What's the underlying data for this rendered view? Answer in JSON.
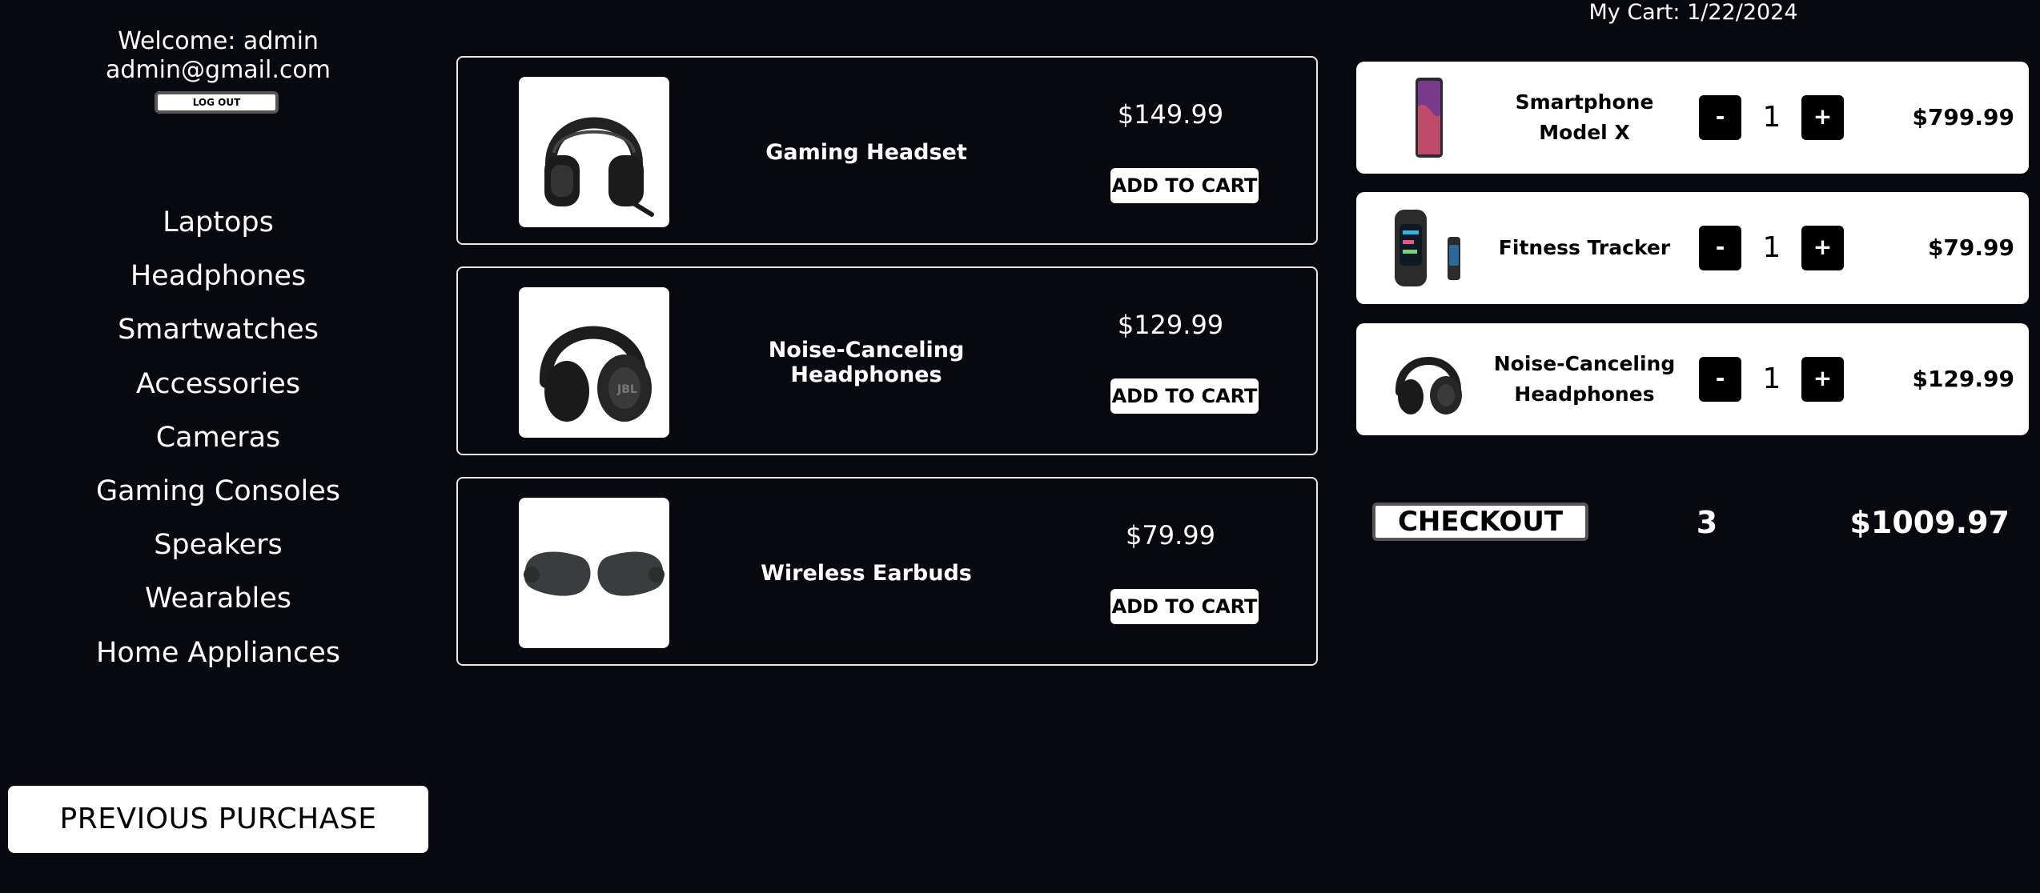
{
  "user": {
    "welcome": "Welcome: admin",
    "email": "admin@gmail.com",
    "logout_label": "LOG OUT"
  },
  "categories": [
    {
      "label": "Laptops"
    },
    {
      "label": "Headphones"
    },
    {
      "label": "Smartwatches"
    },
    {
      "label": "Accessories"
    },
    {
      "label": "Cameras"
    },
    {
      "label": "Gaming Consoles"
    },
    {
      "label": "Speakers"
    },
    {
      "label": "Wearables"
    },
    {
      "label": "Home Appliances"
    }
  ],
  "previous_purchase_label": "PREVIOUS PURCHASE",
  "products": [
    {
      "name": "Gaming Headset",
      "price": "$149.99",
      "button": "ADD TO CART",
      "icon": "gaming-headset-image"
    },
    {
      "name": "Noise-Canceling Headphones",
      "price": "$129.99",
      "button": "ADD TO CART",
      "icon": "headphones-image"
    },
    {
      "name": "Wireless Earbuds",
      "price": "$79.99",
      "button": "ADD TO CART",
      "icon": "earbuds-image"
    }
  ],
  "cart": {
    "title": "My Cart: 1/22/2024",
    "items": [
      {
        "name": "Smartphone Model X",
        "quantity": "1",
        "price": "$799.99",
        "minus": "-",
        "plus": "+",
        "icon": "smartphone-image"
      },
      {
        "name": "Fitness Tracker",
        "quantity": "1",
        "price": "$79.99",
        "minus": "-",
        "plus": "+",
        "icon": "fitness-tracker-image"
      },
      {
        "name": "Noise-Canceling Headphones",
        "quantity": "1",
        "price": "$129.99",
        "minus": "-",
        "plus": "+",
        "icon": "headphones-image"
      }
    ],
    "checkout_label": "CHECKOUT",
    "item_count": "3",
    "total": "$1009.97"
  }
}
